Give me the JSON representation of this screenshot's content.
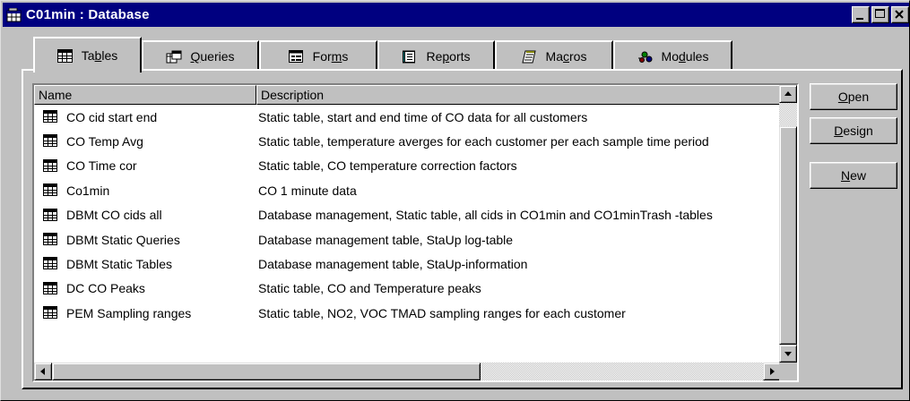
{
  "window": {
    "title": "C01min : Database",
    "controls": [
      "minimize",
      "maximize",
      "close"
    ]
  },
  "tabs": [
    {
      "label": "Tables",
      "mnemonic": "b",
      "icon": "table-icon",
      "active": true
    },
    {
      "label": "Queries",
      "mnemonic": "Q",
      "icon": "query-icon",
      "active": false
    },
    {
      "label": "Forms",
      "mnemonic": "m",
      "icon": "form-icon",
      "active": false
    },
    {
      "label": "Reports",
      "mnemonic": "p",
      "icon": "report-icon",
      "active": false
    },
    {
      "label": "Macros",
      "mnemonic": "c",
      "icon": "macro-icon",
      "active": false
    },
    {
      "label": "Modules",
      "mnemonic": "d",
      "icon": "module-icon",
      "active": false
    }
  ],
  "list": {
    "columns": {
      "name": "Name",
      "description": "Description"
    },
    "rows": [
      {
        "name": "CO cid start end",
        "description": "Static table, start and end time of CO data for all customers"
      },
      {
        "name": "CO Temp Avg",
        "description": "Static table, temperature averges for each customer per each sample time period"
      },
      {
        "name": "CO Time cor",
        "description": "Static table, CO temperature correction factors"
      },
      {
        "name": "Co1min",
        "description": "CO 1 minute data"
      },
      {
        "name": "DBMt CO cids all",
        "description": "Database management, Static table, all cids in CO1min and CO1minTrash -tables"
      },
      {
        "name": "DBMt Static Queries",
        "description": "Database management table, StaUp log-table"
      },
      {
        "name": "DBMt Static Tables",
        "description": "Database management table, StaUp-information"
      },
      {
        "name": "DC CO Peaks",
        "description": "Static table, CO and Temperature peaks"
      },
      {
        "name": "PEM Sampling ranges",
        "description": "Static table, NO2, VOC TMAD sampling ranges for each customer"
      }
    ]
  },
  "buttons": {
    "open": {
      "first": "O",
      "rest": "pen"
    },
    "design": {
      "first": "D",
      "rest": "esign"
    },
    "new": {
      "first": "N",
      "rest": "ew"
    }
  },
  "colors": {
    "title_bar": "#000080",
    "face": "#c0c0c0",
    "window": "#ffffff"
  }
}
